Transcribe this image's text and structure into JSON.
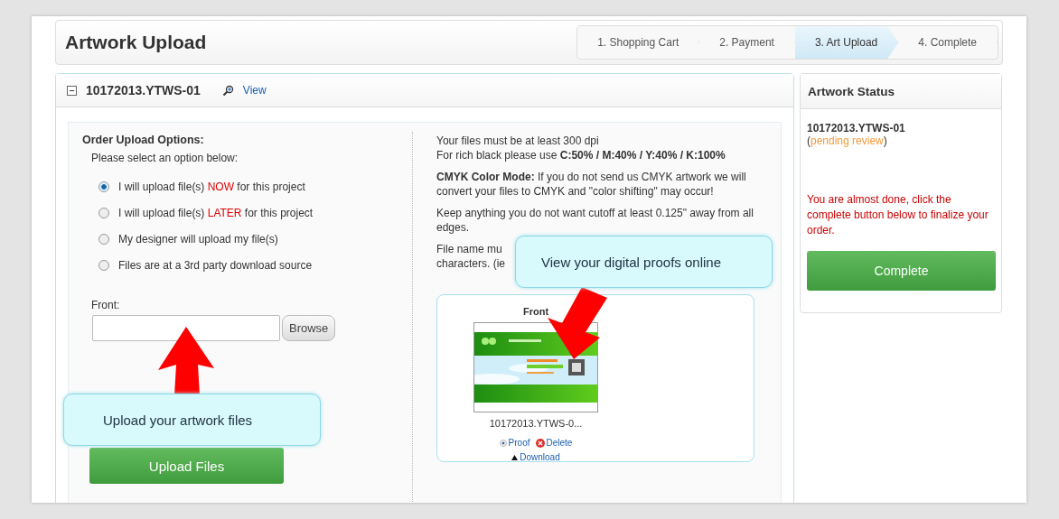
{
  "page_title": "Artwork Upload",
  "steps": [
    {
      "label": "1. Shopping Cart",
      "selected": false
    },
    {
      "label": "2. Payment",
      "selected": false
    },
    {
      "label": "3. Art Upload",
      "selected": true
    },
    {
      "label": "4. Complete",
      "selected": false
    }
  ],
  "order": {
    "id": "10172013.YTWS-01",
    "expanded": true,
    "view_link": "View"
  },
  "upload_options": {
    "heading": "Order Upload Options:",
    "prompt": "Please select an option below:",
    "options": [
      {
        "before": "I will upload file(s) ",
        "highlight": "NOW",
        "after": " for this project",
        "selected": true
      },
      {
        "before": "I will upload file(s) ",
        "highlight": "LATER",
        "after": " for this project",
        "selected": false
      },
      {
        "before": "My designer will upload my file(s)",
        "selected": false
      },
      {
        "before": "Files are at a 3rd party download source",
        "selected": false
      }
    ],
    "field_label": "Front:",
    "browse_button": "Browse",
    "upload_button": "Upload Files"
  },
  "notes": {
    "lines": [
      "Your files must be at least 300 dpi",
      "For rich black please use **C:50% / M:40% / Y:40% / K:100%**"
    ],
    "paragraphs": [
      "**CMYK Color Mode:** If you do not send us CMYK artwork we will convert your files to CMYK and \"color shifting\" may occur!",
      "Keep anything you do not want cutoff at least 0.125\" away from all edges."
    ],
    "covered_lines": [
      "File name mu",
      "characters. (ie"
    ]
  },
  "proof": {
    "side": "Front",
    "file_name": "10172013.YTWS-0...",
    "actions": [
      "Proof",
      "Delete"
    ],
    "download": "Download"
  },
  "callouts": [
    {
      "text": "Upload your artwork files",
      "kind": "up"
    },
    {
      "text": "View your digital proofs online",
      "kind": "down"
    }
  ],
  "status": {
    "heading": "Artwork Status",
    "id": "10172013.YTWS-01",
    "open": "(",
    "state": "pending review",
    "close": ")",
    "message": "You are almost done, click the complete button below to finalize your order.",
    "button": "Complete"
  }
}
